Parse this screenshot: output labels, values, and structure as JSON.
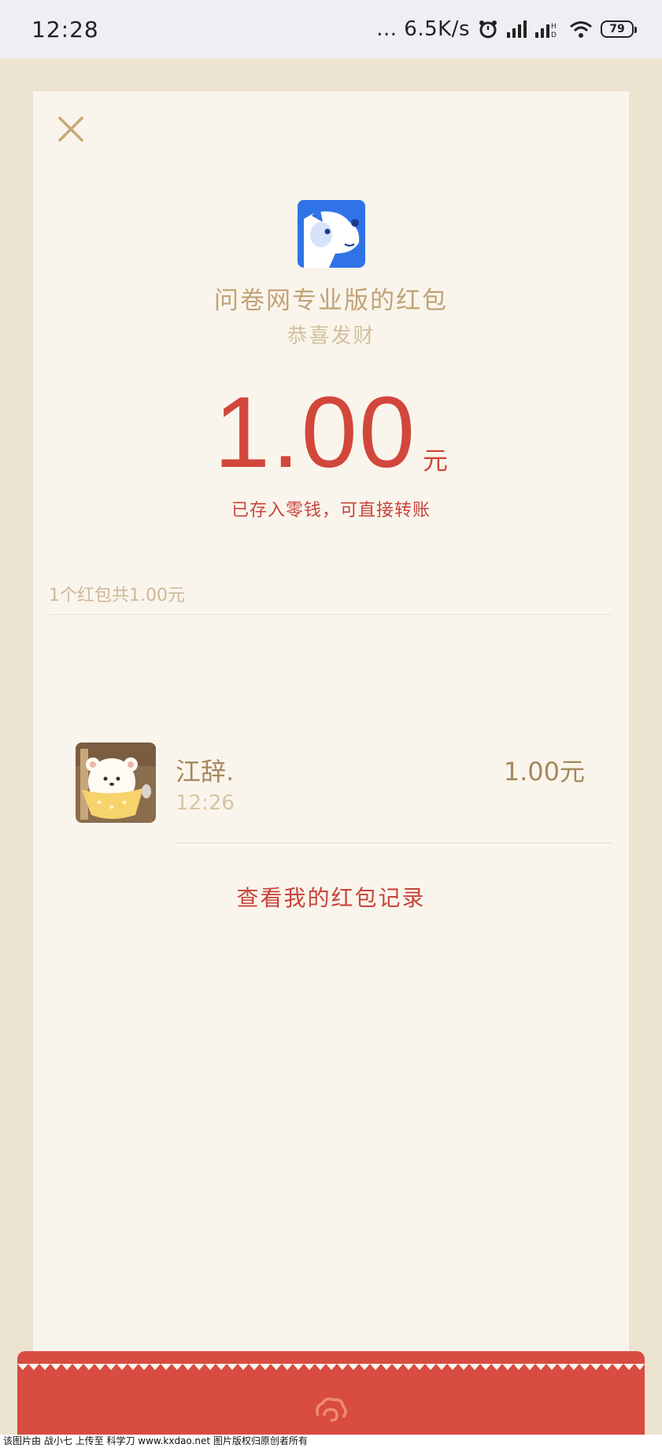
{
  "status_bar": {
    "time": "12:28",
    "network_speed": "... 6.5K/s",
    "battery": "79",
    "icons": [
      "alarm-icon",
      "signal-icon",
      "hd-signal-icon",
      "wifi-icon",
      "battery-icon"
    ]
  },
  "packet": {
    "sender_title": "问卷网专业版的红包",
    "greeting": "恭喜发财",
    "amount": "1.00",
    "unit": "元",
    "saved_note": "已存入零钱，可直接转账",
    "summary": "1个红包共1.00元"
  },
  "records": [
    {
      "name": "江辞.",
      "time": "12:26",
      "amount": "1.00元"
    }
  ],
  "history_link": "查看我的红包记录",
  "footer": {
    "watermark": "该图片由 战小七 上传至 科学刀 www.kxdao.net 图片版权归原创者所有"
  },
  "colors": {
    "accent_red": "#d2473b",
    "gold": "#c0a377",
    "card_bg": "#faf5ec",
    "page_bg": "#ece3d1",
    "app_logo_blue": "#2f73e6"
  }
}
